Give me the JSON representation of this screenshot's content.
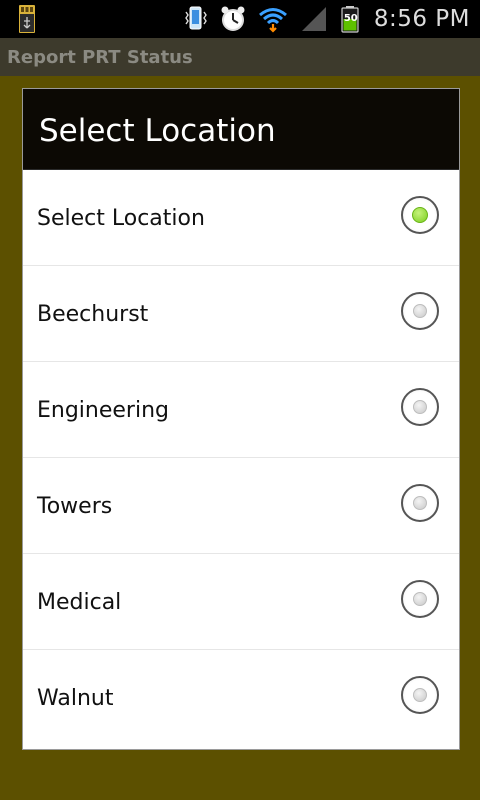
{
  "status_bar": {
    "time": "8:56 PM",
    "battery_level": "50",
    "icons": [
      "usb-debug-icon",
      "vibrate-icon",
      "alarm-icon",
      "wifi-icon",
      "signal-icon",
      "battery-icon"
    ]
  },
  "app": {
    "title": "Report PRT Status"
  },
  "dialog": {
    "title": "Select Location",
    "options": [
      {
        "label": "Select Location",
        "selected": true
      },
      {
        "label": "Beechurst",
        "selected": false
      },
      {
        "label": "Engineering",
        "selected": false
      },
      {
        "label": "Towers",
        "selected": false
      },
      {
        "label": "Medical",
        "selected": false
      },
      {
        "label": "Walnut",
        "selected": false
      }
    ]
  },
  "colors": {
    "backdrop": "#5c5000",
    "dialog_header": "#0c0904",
    "radio_selected": "#7bcf1f"
  }
}
